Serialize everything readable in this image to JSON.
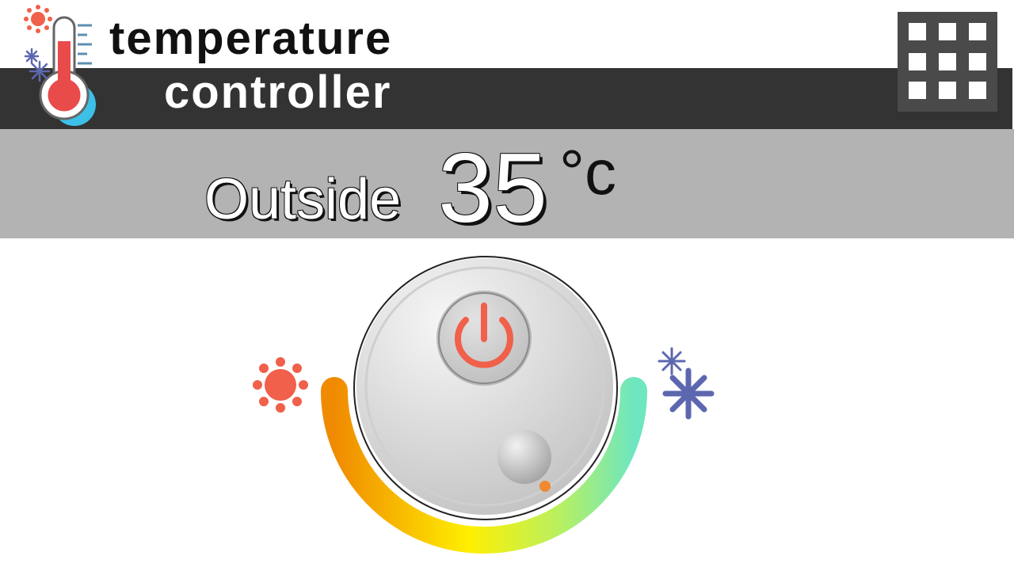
{
  "header": {
    "title_line1": "temperature",
    "title_line2": "controller",
    "logo_icon": "thermometer-icon",
    "menu_icon": "grid-menu-icon"
  },
  "status": {
    "label": "Outside",
    "value": "35",
    "unit": "°c"
  },
  "dial": {
    "power_icon": "power-icon",
    "hot_icon": "sun-icon",
    "cold_icon": "snowflake-icon"
  },
  "colors": {
    "header_band": "#333333",
    "status_band": "#b3b3b3",
    "menu_button": "#4a4a4a",
    "power_red": "#f0604a",
    "sun": "#f0604a",
    "snowflake": "#5d67b0",
    "arc_hot": "#f08a00",
    "arc_mid": "#ffef00",
    "arc_cool": "#6ee6c0"
  }
}
